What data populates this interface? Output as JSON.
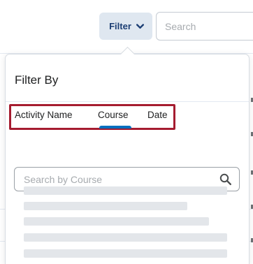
{
  "toolbar": {
    "filter_label": "Filter",
    "search_placeholder": "Search"
  },
  "filter_dropdown": {
    "title": "Filter By",
    "tabs": [
      {
        "label": "Activity Name",
        "selected": false
      },
      {
        "label": "Course",
        "selected": true
      },
      {
        "label": "Date",
        "selected": false
      }
    ],
    "course_search_placeholder": "Search by Course",
    "loading_placeholder_rows": 5
  },
  "icons": {
    "filter_chevron": "chevron-down-icon",
    "course_search": "search-icon"
  },
  "colors": {
    "filter_button_bg": "#dfe7f0",
    "filter_button_text": "#1d3f74",
    "selected_tab_indicator": "#006fbf",
    "highlight_outline": "#a51c30",
    "skeleton": "#e3e6ea"
  }
}
